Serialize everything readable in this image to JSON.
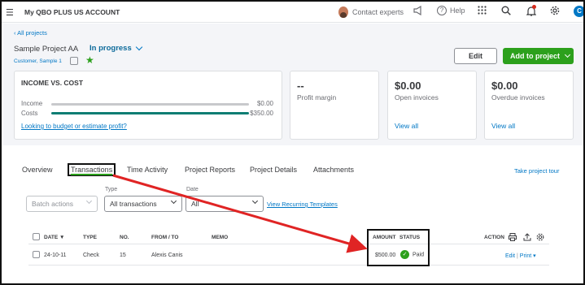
{
  "topbar": {
    "company": "My QBO PLUS US ACCOUNT",
    "contact_label": "Contact experts",
    "help_label": "Help",
    "user_initial": "C"
  },
  "project": {
    "back_link": "All projects",
    "name": "Sample Project AA",
    "status": "In progress",
    "customer": "Customer, Sample 1",
    "edit_label": "Edit",
    "add_label": "Add to project"
  },
  "cards": {
    "income_vs_cost": {
      "title": "INCOME VS. COST",
      "income_label": "Income",
      "income_value": "$0.00",
      "costs_label": "Costs",
      "costs_value": "$350.00",
      "link": "Looking to budget or estimate profit?"
    },
    "profit_margin": {
      "value": "--",
      "label": "Profit margin"
    },
    "open_invoices": {
      "value": "$0.00",
      "label": "Open invoices",
      "link": "View all"
    },
    "overdue_invoices": {
      "value": "$0.00",
      "label": "Overdue invoices",
      "link": "View all"
    }
  },
  "tabs": [
    {
      "label": "Overview"
    },
    {
      "label": "Transactions"
    },
    {
      "label": "Time Activity"
    },
    {
      "label": "Project Reports"
    },
    {
      "label": "Project Details"
    },
    {
      "label": "Attachments"
    }
  ],
  "tour_link": "Take project tour",
  "filters": {
    "batch_actions": "Batch actions",
    "type_label": "Type",
    "type_value": "All transactions",
    "date_label": "Date",
    "date_value": "All",
    "recurring_link": "View Recurring Templates"
  },
  "table": {
    "headers": {
      "date": "DATE",
      "date_sort": "▼",
      "type": "TYPE",
      "no": "NO.",
      "from_to": "FROM / TO",
      "memo": "MEMO",
      "amount": "AMOUNT",
      "status": "STATUS",
      "action": "ACTION"
    },
    "rows": [
      {
        "date": "24-10-11",
        "type": "Check",
        "no": "15",
        "from_to": "Alexis Canis",
        "memo": "",
        "amount": "$500.00",
        "status": "Paid",
        "action_edit": "Edit",
        "action_print": "Print"
      }
    ]
  },
  "colors": {
    "brand_green": "#2ca01c",
    "link_blue": "#0077c5",
    "cost_bar": "#0d7d73",
    "income_bar": "#c8c9cc",
    "annotation_arrow": "#e02424"
  }
}
